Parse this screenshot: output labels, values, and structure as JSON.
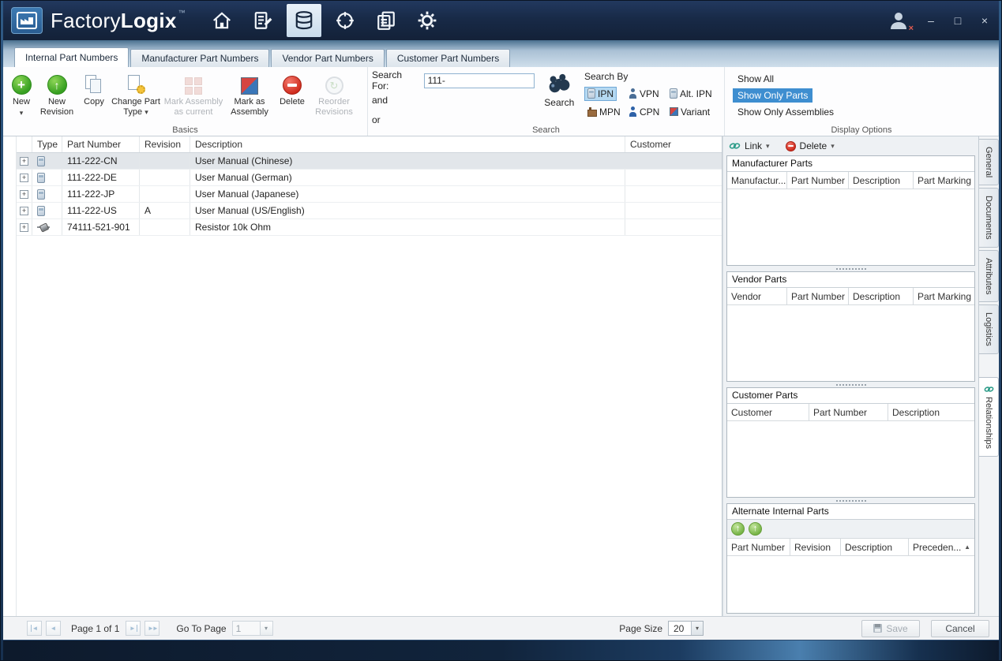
{
  "titlebar": {
    "brand_primary": "Factory",
    "brand_secondary": "Logix",
    "trademark": "™"
  },
  "tabs": [
    {
      "label": "Internal Part Numbers",
      "active": true
    },
    {
      "label": "Manufacturer Part Numbers",
      "active": false
    },
    {
      "label": "Vendor Part Numbers",
      "active": false
    },
    {
      "label": "Customer Part Numbers",
      "active": false
    }
  ],
  "ribbon": {
    "basics": {
      "label": "Basics",
      "buttons": [
        {
          "label": "New",
          "enabled": true
        },
        {
          "label": "New Revision",
          "enabled": true
        },
        {
          "label": "Copy",
          "enabled": true
        },
        {
          "label": "Change Part Type",
          "enabled": true
        },
        {
          "label": "Mark Assembly as current",
          "enabled": false
        },
        {
          "label": "Mark as Assembly",
          "enabled": true
        },
        {
          "label": "Delete",
          "enabled": true
        },
        {
          "label": "Reorder Revisions",
          "enabled": false
        }
      ]
    },
    "search": {
      "label": "Search",
      "search_for_label": "Search For:",
      "value": "111-",
      "and_label": "and",
      "or_label": "or",
      "button_label": "Search",
      "by_label": "Search By",
      "by_options": [
        {
          "label": "IPN",
          "selected": true
        },
        {
          "label": "VPN",
          "selected": false
        },
        {
          "label": "Alt. IPN",
          "selected": false
        },
        {
          "label": "MPN",
          "selected": false
        },
        {
          "label": "CPN",
          "selected": false
        },
        {
          "label": "Variant",
          "selected": false
        }
      ]
    },
    "display": {
      "label": "Display Options",
      "options": [
        {
          "label": "Show All",
          "selected": false
        },
        {
          "label": "Show Only Parts",
          "selected": true
        },
        {
          "label": "Show Only Assemblies",
          "selected": false
        }
      ]
    }
  },
  "table": {
    "columns": [
      "Type",
      "Part Number",
      "Revision",
      "Description",
      "Customer"
    ],
    "rows": [
      {
        "type_icon": "document-icon",
        "part_number": "111-222-CN",
        "revision": "",
        "description": "User Manual (Chinese)",
        "customer": "",
        "selected": true
      },
      {
        "type_icon": "document-icon",
        "part_number": "111-222-DE",
        "revision": "",
        "description": "User Manual (German)",
        "customer": "",
        "selected": false
      },
      {
        "type_icon": "document-icon",
        "part_number": "111-222-JP",
        "revision": "",
        "description": "User Manual (Japanese)",
        "customer": "",
        "selected": false
      },
      {
        "type_icon": "document-icon",
        "part_number": "111-222-US",
        "revision": "A",
        "description": "User Manual (US/English)",
        "customer": "",
        "selected": false
      },
      {
        "type_icon": "resistor-icon",
        "part_number": "74111-521-901",
        "revision": "",
        "description": "Resistor 10k Ohm",
        "customer": "",
        "selected": false
      }
    ]
  },
  "panel": {
    "link_label": "Link",
    "delete_label": "Delete",
    "sections": [
      {
        "title": "Manufacturer Parts",
        "columns": [
          "Manufactur...",
          "Part Number",
          "Description",
          "Part Marking"
        ]
      },
      {
        "title": "Vendor Parts",
        "columns": [
          "Vendor",
          "Part Number",
          "Description",
          "Part Marking"
        ]
      },
      {
        "title": "Customer Parts",
        "columns": [
          "Customer",
          "Part Number",
          "Description"
        ]
      },
      {
        "title": "Alternate Internal Parts",
        "columns": [
          "Part Number",
          "Revision",
          "Description",
          "Preceden..."
        ]
      }
    ]
  },
  "side_tabs": [
    {
      "label": "General",
      "active": false
    },
    {
      "label": "Documents",
      "active": false
    },
    {
      "label": "Attributes",
      "active": false
    },
    {
      "label": "Logistics",
      "active": false
    },
    {
      "label": "Relationships",
      "active": true
    }
  ],
  "footer": {
    "page_label": "Page 1 of 1",
    "goto_label": "Go To Page",
    "goto_value": "1",
    "page_size_label": "Page Size",
    "page_size_value": "20",
    "save_label": "Save",
    "cancel_label": "Cancel"
  },
  "icons": {
    "caret_down": "▾",
    "sort_asc": "▲",
    "plus": "+",
    "up_arrow": "↑",
    "refresh": "↻",
    "minimize": "–",
    "maximize": "□",
    "close": "×",
    "prev_arrow": "◄",
    "next_arrow": "►",
    "last_arrows": "►►"
  }
}
